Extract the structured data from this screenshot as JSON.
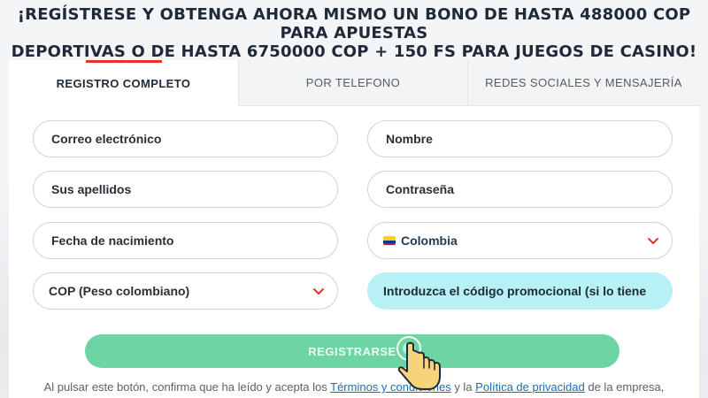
{
  "headline": {
    "line1": "¡REGÍSTRESE Y OBTENGA AHORA MISMO UN BONO DE HASTA 488000 COP PARA APUESTAS",
    "line2": "DEPORTIVAS O DE HASTA 6750000 COP + 150 FS PARA JUEGOS DE CASINO!"
  },
  "tabs": [
    {
      "label": "REGISTRO COMPLETO",
      "active": true
    },
    {
      "label": "POR TELEFONO",
      "active": false
    },
    {
      "label": "REDES SOCIALES Y MENSAJERÍA",
      "active": false
    }
  ],
  "form": {
    "email_placeholder": "Correo electrónico",
    "name_placeholder": "Nombre",
    "surname_placeholder": "Sus apellidos",
    "password_placeholder": "Contraseña",
    "birthdate_placeholder": "Fecha de nacimiento",
    "country_value": "Colombia",
    "currency_value": "COP (Peso colombiano)",
    "promo_placeholder": "Introduzca el código promocional (si lo tiene"
  },
  "register_button": {
    "label": "REGISTRARSE"
  },
  "legal": {
    "prefix": "Al pulsar este botón, confirma que ha leído y acepta los ",
    "terms_link": "Términos y condiciones",
    "middle": " y la ",
    "privacy_link": "Política de privacidad",
    "suffix": " de la empresa,"
  },
  "colors": {
    "accent_red": "#e3342f",
    "button_green": "#6dd4a3",
    "promo_cyan": "#b7f0f5",
    "link_blue": "#1c6fb6"
  },
  "icons": {
    "select_arrow": "chevron-down-icon",
    "country_flag": "colombia-flag-icon",
    "pointer": "hand-pointer-icon"
  }
}
